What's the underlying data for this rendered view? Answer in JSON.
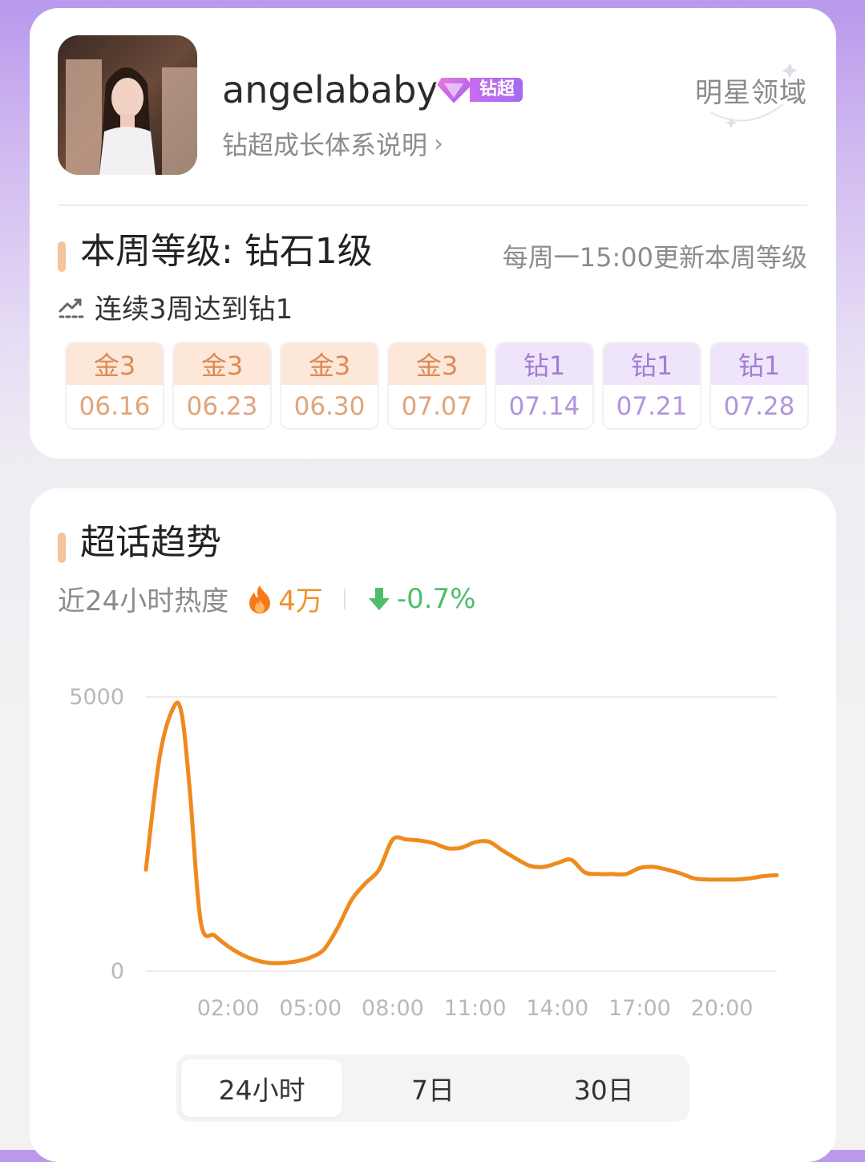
{
  "profile": {
    "username": "angelababy",
    "badge_label": "钻超",
    "growth_link": "钻超成长体系说明",
    "domain_label": "明星领域"
  },
  "level": {
    "title": "本周等级: 钻石1级",
    "update_note": "每周一15:00更新本周等级",
    "streak": "连续3周达到钻1",
    "weeks": [
      {
        "level": "金3",
        "date": "06.16",
        "tier": "gold"
      },
      {
        "level": "金3",
        "date": "06.23",
        "tier": "gold"
      },
      {
        "level": "金3",
        "date": "06.30",
        "tier": "gold"
      },
      {
        "level": "金3",
        "date": "07.07",
        "tier": "gold"
      },
      {
        "level": "钻1",
        "date": "07.14",
        "tier": "diamond"
      },
      {
        "level": "钻1",
        "date": "07.21",
        "tier": "diamond"
      },
      {
        "level": "钻1",
        "date": "07.28",
        "tier": "diamond"
      }
    ]
  },
  "trend": {
    "title": "超话趋势",
    "heat_label": "近24小时热度",
    "heat_value": "4万",
    "change": "-0.7%",
    "tabs": [
      {
        "label": "24小时",
        "active": true
      },
      {
        "label": "7日",
        "active": false
      },
      {
        "label": "30日",
        "active": false
      }
    ]
  },
  "chart_data": {
    "type": "line",
    "title": "",
    "xlabel": "",
    "ylabel": "",
    "ylim": [
      0,
      5000
    ],
    "y_ticks": [
      "5000",
      "0"
    ],
    "x_ticks": [
      "02:00",
      "05:00",
      "08:00",
      "11:00",
      "14:00",
      "17:00",
      "20:00"
    ],
    "x_tick_hours": [
      2,
      5,
      8,
      11,
      14,
      17,
      20
    ],
    "x_range_hours": [
      -1,
      22
    ],
    "grid": true,
    "color": "#ef8a1f",
    "series": [
      {
        "x": [
          -1,
          -0.5,
          0,
          0.3,
          0.6,
          1,
          1.5,
          2,
          2.5,
          3,
          3.5,
          4,
          4.5,
          5,
          5.5,
          6,
          6.5,
          7,
          7.5,
          8,
          8.5,
          9,
          9.5,
          10,
          10.5,
          11,
          11.5,
          12,
          12.5,
          13,
          13.5,
          14,
          14.5,
          15,
          15.5,
          16,
          16.5,
          17,
          17.5,
          18,
          18.5,
          19,
          19.5,
          20,
          20.5,
          21,
          21.5,
          22
        ],
        "values": [
          1850,
          3900,
          4800,
          4700,
          3300,
          900,
          650,
          450,
          300,
          200,
          150,
          150,
          180,
          250,
          400,
          800,
          1300,
          1600,
          1850,
          2400,
          2400,
          2380,
          2330,
          2240,
          2250,
          2350,
          2360,
          2200,
          2050,
          1920,
          1900,
          1970,
          2030,
          1800,
          1770,
          1770,
          1770,
          1880,
          1900,
          1850,
          1780,
          1690,
          1670,
          1670,
          1670,
          1690,
          1730,
          1750
        ]
      }
    ]
  }
}
